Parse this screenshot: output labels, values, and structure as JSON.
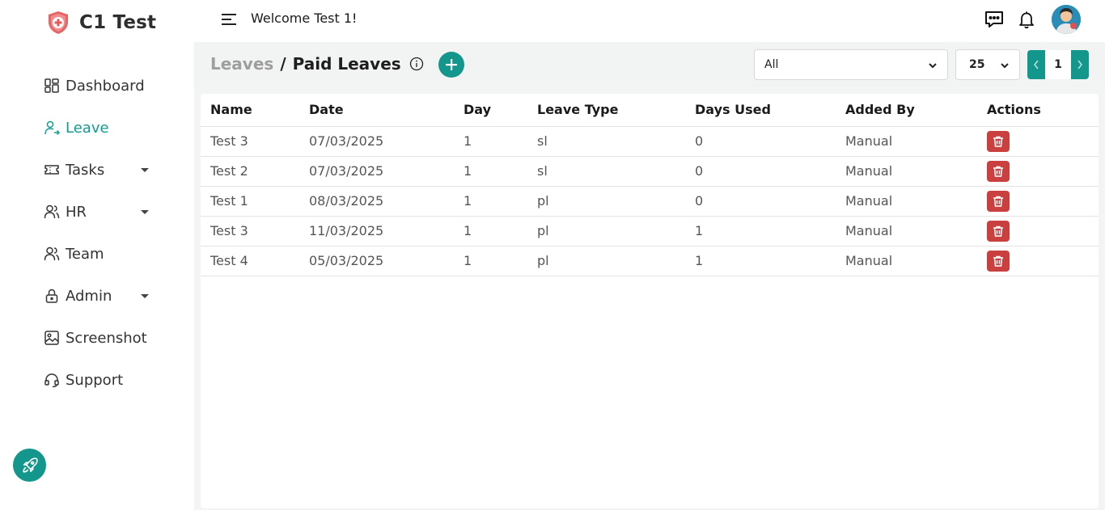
{
  "app": {
    "title": "C1 Test"
  },
  "sidebar": {
    "items": [
      {
        "label": "Dashboard",
        "icon": "dashboard-icon",
        "active": false,
        "has_caret": false
      },
      {
        "label": "Leave",
        "icon": "user-arrow-icon",
        "active": true,
        "has_caret": false
      },
      {
        "label": "Tasks",
        "icon": "ticket-icon",
        "active": false,
        "has_caret": true
      },
      {
        "label": "HR",
        "icon": "users-icon",
        "active": false,
        "has_caret": true
      },
      {
        "label": "Team",
        "icon": "team-icon",
        "active": false,
        "has_caret": false
      },
      {
        "label": "Admin",
        "icon": "lock-icon",
        "active": false,
        "has_caret": true
      },
      {
        "label": "Screenshot",
        "icon": "image-icon",
        "active": false,
        "has_caret": false
      },
      {
        "label": "Support",
        "icon": "headset-icon",
        "active": false,
        "has_caret": false
      }
    ]
  },
  "topbar": {
    "welcome": "Welcome Test 1!"
  },
  "header": {
    "breadcrumb_parent": "Leaves",
    "breadcrumb_sep": "/",
    "breadcrumb_current": "Paid Leaves",
    "filter_value": "All",
    "page_size": "25",
    "current_page": "1"
  },
  "table": {
    "columns": [
      "Name",
      "Date",
      "Day",
      "Leave Type",
      "Days Used",
      "Added By",
      "Actions"
    ],
    "rows": [
      [
        "Test 3",
        "07/03/2025",
        "1",
        "sl",
        "0",
        "Manual"
      ],
      [
        "Test 2",
        "07/03/2025",
        "1",
        "sl",
        "0",
        "Manual"
      ],
      [
        "Test 1",
        "08/03/2025",
        "1",
        "pl",
        "0",
        "Manual"
      ],
      [
        "Test 3",
        "11/03/2025",
        "1",
        "pl",
        "1",
        "Manual"
      ],
      [
        "Test 4",
        "05/03/2025",
        "1",
        "pl",
        "1",
        "Manual"
      ]
    ]
  },
  "colors": {
    "accent": "#13968c",
    "danger": "#c9403f",
    "logo": "#e65a5a"
  }
}
